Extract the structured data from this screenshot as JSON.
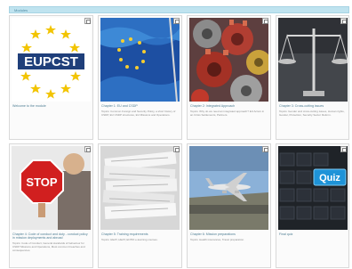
{
  "breadcrumb": "Modules",
  "cards": [
    {
      "title": "Welcome to the module",
      "description": "",
      "logo_text": "EUPCST",
      "icon": "eupcst-logo-image"
    },
    {
      "title": "Chapter 1: EU and CSDP",
      "description": "Topics: Common Foreign and Security Policy, a short history of CSDP, EU CSDP structures, EU Missions and Operations.",
      "icon": "eu-flag-image"
    },
    {
      "title": "Chapter 2: Integrated Approach",
      "description": "Topics: Why do we need an integrated approach? EU Actors in an Crisis Settlements, Partners.",
      "icon": "gears-image"
    },
    {
      "title": "Chapter 3: Cross-cutting issues",
      "description": "Topics: Gender and cross-cutting issues, Human rights, Gender, Protection, Security Sector Reform.",
      "icon": "scales-image"
    },
    {
      "title": "Chapter 4: Code of conduct and duty - conduct policy in mission deployments and abroad",
      "description": "Topics: Code of Conduct, General standards of behaviour for CSDP Missions and Operations, Most common breaches and consequences.",
      "sign_text": "STOP",
      "icon": "stop-sign-image"
    },
    {
      "title": "Chapter 5: Training requirements",
      "description": "Topics: HEAT, HEAT, ENTRi e-learning courses.",
      "icon": "documents-image"
    },
    {
      "title": "Chapter 6: Mission preparations",
      "description": "Topics: Health insurances, Travel preparation.",
      "icon": "airplane-image"
    },
    {
      "title": "Final quiz",
      "description": "",
      "key_text": "Quiz",
      "icon": "quiz-keyboard-image"
    }
  ]
}
